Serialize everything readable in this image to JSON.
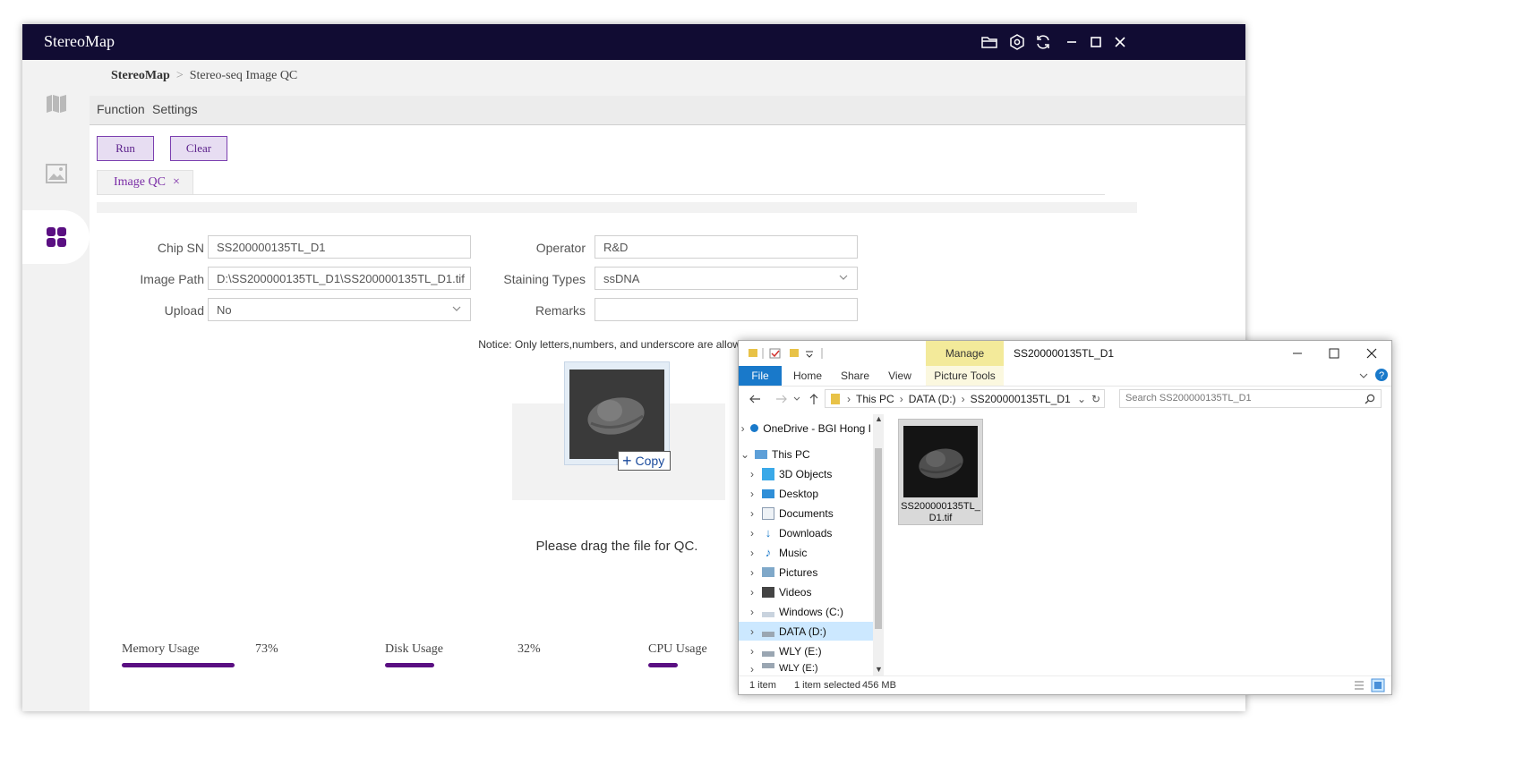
{
  "app": {
    "title": "StereoMap",
    "breadcrumb": {
      "root": "StereoMap",
      "current": "Stereo-seq Image QC"
    },
    "menu": [
      "Function",
      "Settings"
    ],
    "buttons": {
      "run": "Run",
      "clear": "Clear"
    },
    "tab": {
      "label": "Image QC",
      "close": "×"
    },
    "form": {
      "chip_sn": {
        "label": "Chip SN",
        "value": "SS200000135TL_D1"
      },
      "image_path": {
        "label": "Image Path",
        "value": "D:\\SS200000135TL_D1\\SS200000135TL_D1.tif"
      },
      "upload": {
        "label": "Upload",
        "value": "No"
      },
      "operator": {
        "label": "Operator",
        "value": "R&D"
      },
      "staining": {
        "label": "Staining Types",
        "value": "ssDNA"
      },
      "remarks": {
        "label": "Remarks",
        "value": ""
      }
    },
    "notice": "Notice: Only letters,numbers, and underscore are allowed.",
    "drag_hint": "Please drag the file for QC.",
    "drag_copy": "Copy",
    "usage": [
      {
        "label": "Memory Usage",
        "value": "73%",
        "fraction": 0.73
      },
      {
        "label": "Disk Usage",
        "value": "32%",
        "fraction": 0.32
      },
      {
        "label": "CPU Usage",
        "value": "",
        "fraction": 0.19
      }
    ],
    "accent_color": "#5a0f82",
    "titlebar_color": "#110c33",
    "titlebar_icons": [
      "folder-open-icon",
      "settings-hex-icon",
      "refresh-icon",
      "minimize-icon",
      "maximize-icon",
      "close-icon"
    ],
    "sidebar_icons": [
      "map-icon",
      "image-icon",
      "apps-grid-icon"
    ]
  },
  "explorer": {
    "title": "SS200000135TL_D1",
    "manage": "Manage",
    "ribbon_tabs": [
      "File",
      "Home",
      "Share",
      "View",
      "Picture Tools"
    ],
    "address": [
      "This PC",
      "DATA (D:)",
      "SS200000135TL_D1"
    ],
    "search_placeholder": "Search SS200000135TL_D1",
    "nav": [
      {
        "label": "OneDrive - BGI Hong I",
        "icon": "cloud-icon"
      },
      {
        "label": "This PC",
        "icon": "pc-icon"
      },
      {
        "label": "3D Objects",
        "icon": "cube-icon"
      },
      {
        "label": "Desktop",
        "icon": "desktop-icon"
      },
      {
        "label": "Documents",
        "icon": "document-icon"
      },
      {
        "label": "Downloads",
        "icon": "download-icon"
      },
      {
        "label": "Music",
        "icon": "music-icon"
      },
      {
        "label": "Pictures",
        "icon": "pictures-icon"
      },
      {
        "label": "Videos",
        "icon": "video-icon"
      },
      {
        "label": "Windows (C:)",
        "icon": "drive-icon"
      },
      {
        "label": "DATA (D:)",
        "icon": "drive-icon",
        "selected": true
      },
      {
        "label": "WLY (E:)",
        "icon": "drive-icon"
      },
      {
        "label": "WLY (E:)",
        "icon": "drive-icon"
      }
    ],
    "file": {
      "name": "SS200000135TL_D1.tif"
    },
    "status": {
      "count": "1 item",
      "selected": "1 item selected",
      "size": "456 MB"
    },
    "accent_color": "#1979ca"
  }
}
